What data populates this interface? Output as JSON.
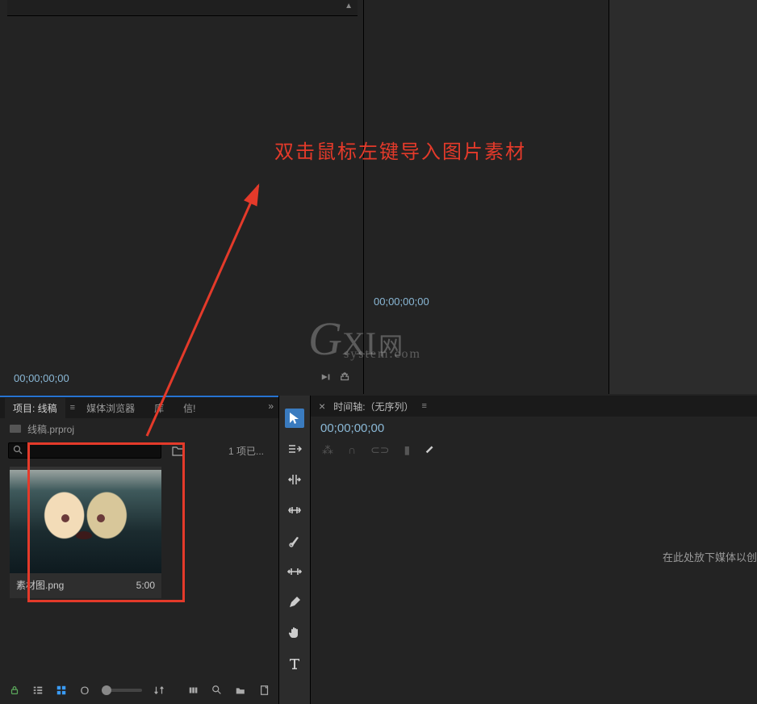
{
  "source_monitor": {
    "timecode": "00;00;00;00"
  },
  "program_monitor": {
    "timecode": "00;00;00;00"
  },
  "project_panel": {
    "tabs": [
      {
        "label": "项目: 线稿",
        "active": true
      },
      {
        "label": "媒体浏览器",
        "active": false
      },
      {
        "label": "库",
        "active": false
      },
      {
        "label": "信!",
        "active": false
      }
    ],
    "project_file": "线稿.prproj",
    "search_placeholder": "",
    "item_count_label": "1 项已...",
    "clip": {
      "name": "素材图.png",
      "duration": "5:00"
    }
  },
  "timeline": {
    "title": "时间轴:（无序列）",
    "timecode": "00;00;00;00",
    "drop_hint": "在此处放下媒体以创"
  },
  "annotation": {
    "text": "双击鼠标左键导入图片素材"
  },
  "watermark": {
    "brand_g": "G",
    "brand_xi": "XI",
    "brand_cn": "网",
    "sub": "system.com"
  }
}
